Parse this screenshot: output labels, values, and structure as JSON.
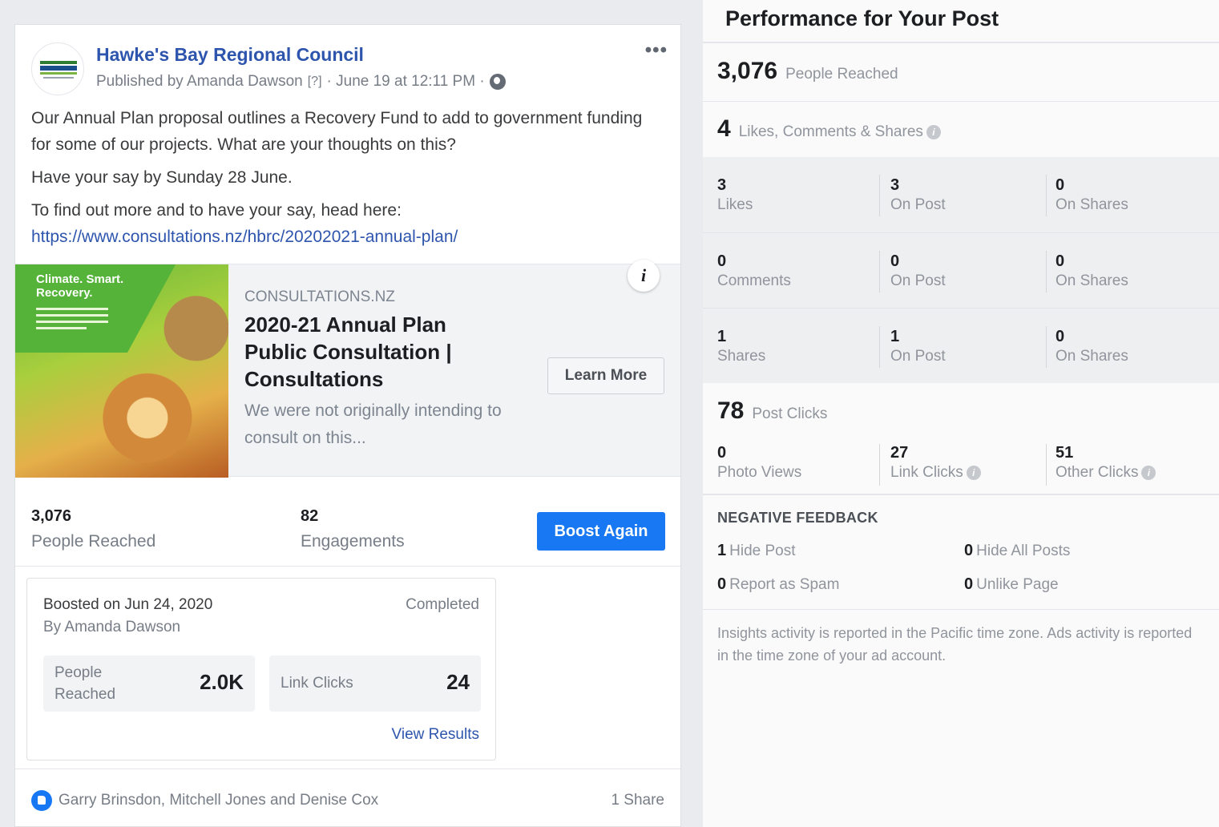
{
  "post": {
    "page_name": "Hawke's Bay Regional Council",
    "published_by": "Published by Amanda Dawson",
    "help_marker": "[?]",
    "date": "· June 19 at 12:11 PM ·",
    "more_label": "•••",
    "body": [
      "Our Annual Plan proposal outlines a Recovery Fund to add to government funding for some of our projects. What are your thoughts on this?",
      "Have your say by Sunday 28 June.",
      "To find out more and to have your say, head here:"
    ],
    "link": "https://www.consultations.nz/hbrc/20202021-annual-plan/"
  },
  "preview": {
    "image_text": "Climate. Smart. Recovery.",
    "info_label": "i",
    "domain": "CONSULTATIONS.NZ",
    "title": "2020-21 Annual Plan Public Consultation | Consultations",
    "description": "We were not originally intending to consult on this...",
    "cta": "Learn More"
  },
  "stats": {
    "reached_value": "3,076",
    "reached_label": "People Reached",
    "engagements_value": "82",
    "engagements_label": "Engagements",
    "boost_button": "Boost Again"
  },
  "boost": {
    "date": "Boosted on Jun 24, 2020",
    "by": "By Amanda Dawson",
    "status": "Completed",
    "people_label_1": "People",
    "people_label_2": "Reached",
    "people_value": "2.0K",
    "clicks_label": "Link Clicks",
    "clicks_value": "24",
    "view_results": "View Results"
  },
  "reactions": {
    "names": "Garry Brinsdon, Mitchell Jones and Denise Cox",
    "shares": "1 Share"
  },
  "performance": {
    "title": "Performance for Your Post",
    "reached_num": "3,076",
    "reached_label": "People Reached",
    "engagement_num": "4",
    "engagement_label": "Likes, Comments & Shares",
    "rows": [
      {
        "a_num": "3",
        "a_label": "Likes",
        "b_num": "3",
        "b_label": "On Post",
        "c_num": "0",
        "c_label": "On Shares"
      },
      {
        "a_num": "0",
        "a_label": "Comments",
        "b_num": "0",
        "b_label": "On Post",
        "c_num": "0",
        "c_label": "On Shares"
      },
      {
        "a_num": "1",
        "a_label": "Shares",
        "b_num": "1",
        "b_label": "On Post",
        "c_num": "0",
        "c_label": "On Shares"
      }
    ],
    "clicks_num": "78",
    "clicks_label": "Post Clicks",
    "photo_views_num": "0",
    "photo_views_label": "Photo Views",
    "link_clicks_num": "27",
    "link_clicks_label": "Link Clicks",
    "other_clicks_num": "51",
    "other_clicks_label": "Other Clicks",
    "negative_title": "NEGATIVE FEEDBACK",
    "hide_post_num": "1",
    "hide_post_label": "Hide Post",
    "hide_all_num": "0",
    "hide_all_label": "Hide All Posts",
    "spam_num": "0",
    "spam_label": "Report as Spam",
    "unlike_num": "0",
    "unlike_label": "Unlike Page",
    "footnote": "Insights activity is reported in the Pacific time zone. Ads activity is reported in the time zone of your ad account."
  },
  "colors": {
    "link_blue": "#2e55ad",
    "button_blue": "#1877f2",
    "muted_text": "#90949c"
  }
}
